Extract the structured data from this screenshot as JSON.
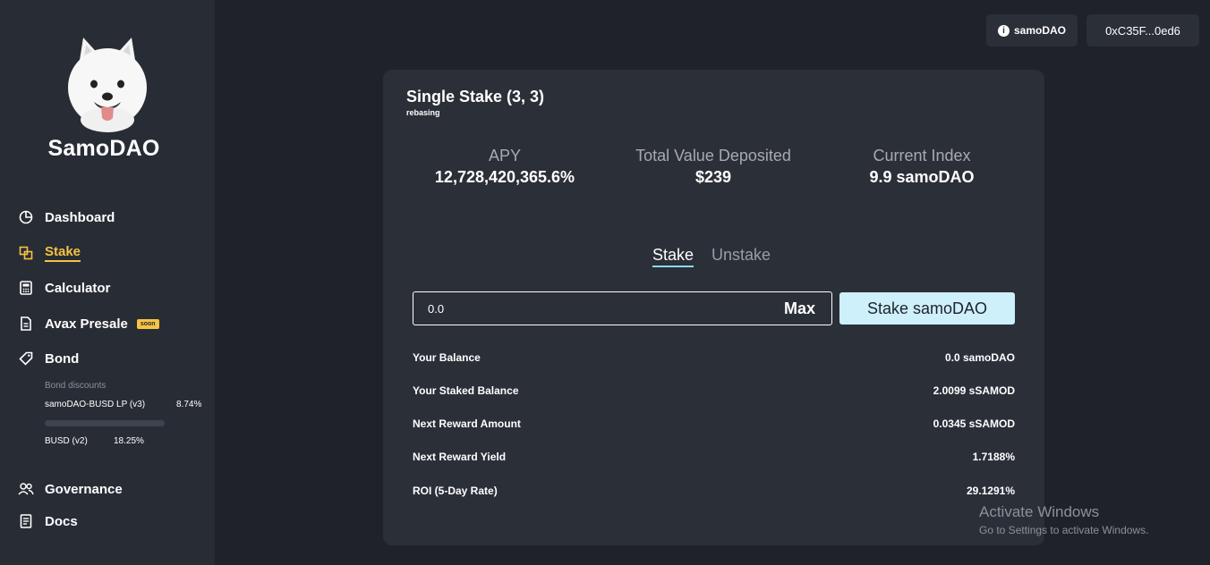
{
  "brand": {
    "name": "SamoDAO"
  },
  "sidebar": {
    "items": [
      {
        "label": "Dashboard",
        "icon": "pie-chart-icon"
      },
      {
        "label": "Stake",
        "icon": "stake-icon",
        "active": true
      },
      {
        "label": "Calculator",
        "icon": "calculator-icon"
      },
      {
        "label": "Avax Presale",
        "icon": "document-icon",
        "badge": "soon"
      },
      {
        "label": "Bond",
        "icon": "tag-icon"
      }
    ],
    "bond_discounts": {
      "title": "Bond discounts",
      "rows": [
        {
          "name": "samoDAO-BUSD LP (v3)",
          "value": "8.74%"
        },
        {
          "name": "BUSD (v2)",
          "value": "18.25%"
        }
      ]
    },
    "bottom_items": [
      {
        "label": "Governance",
        "icon": "people-icon"
      },
      {
        "label": "Docs",
        "icon": "docs-icon"
      }
    ]
  },
  "header": {
    "token_button": "samoDAO",
    "wallet_address": "0xC35F...0ed6"
  },
  "stake_card": {
    "title": "Single Stake (3, 3)",
    "subtitle": "rebasing",
    "metrics": [
      {
        "label": "APY",
        "value": "12,728,420,365.6%"
      },
      {
        "label": "Total Value Deposited",
        "value": "$239"
      },
      {
        "label": "Current Index",
        "value": "9.9 samoDAO"
      }
    ],
    "tabs": {
      "stake": "Stake",
      "unstake": "Unstake"
    },
    "input": {
      "value": "0.0",
      "max_label": "Max"
    },
    "action_button": "Stake samoDAO",
    "stats": [
      {
        "label": "Your Balance",
        "value": "0.0 samoDAO"
      },
      {
        "label": "Your Staked Balance",
        "value": "2.0099 sSAMOD"
      },
      {
        "label": "Next Reward Amount",
        "value": "0.0345 sSAMOD"
      },
      {
        "label": "Next Reward Yield",
        "value": "1.7188%"
      },
      {
        "label": "ROI (5-Day Rate)",
        "value": "29.1291%"
      }
    ]
  },
  "watermark": {
    "title": "Activate Windows",
    "subtitle": "Go to Settings to activate Windows."
  },
  "colors": {
    "background": "#1f222b",
    "sidebar": "#282c35",
    "card": "#2b2f38",
    "accent": "#f6c343",
    "button": "#cdf0fb"
  }
}
